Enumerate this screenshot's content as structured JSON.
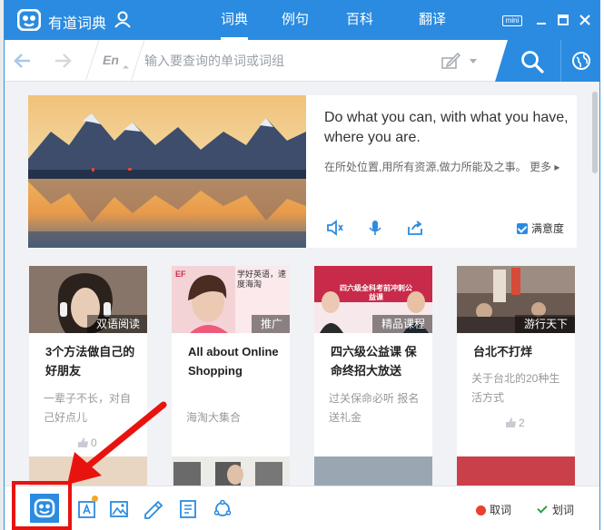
{
  "app": {
    "name": "有道词典",
    "brand_color": "#2a8be0"
  },
  "tabs": [
    {
      "label": "词典",
      "active": true
    },
    {
      "label": "例句",
      "active": false
    },
    {
      "label": "百科",
      "active": false
    },
    {
      "label": "翻译",
      "active": false
    }
  ],
  "window_controls": {
    "mini_label": "mini"
  },
  "search": {
    "lang": "En",
    "placeholder": "输入要查询的单词或词组"
  },
  "banner": {
    "quote_en": "Do what you can, with what you have, where you are.",
    "quote_zh": "在所处位置,用所有资源,做力所能及之事。",
    "more": "更多 ▸",
    "satisfaction_label": "满意度"
  },
  "cards": [
    {
      "tag": "双语阅读",
      "title": "3个方法做自己的好朋友",
      "desc": "一辈子不长，对自己好点儿",
      "likes": "0"
    },
    {
      "tag": "推广",
      "title": "All about Online Shopping",
      "desc": "海淘大集合",
      "likes": ""
    },
    {
      "tag": "精品课程",
      "title": "四六级公益课 保命终招大放送",
      "desc": "过关保命必听 报名送礼金",
      "likes": ""
    },
    {
      "tag": "游行天下",
      "title": "台北不打烊",
      "desc": "关于台北的20种生活方式",
      "likes": "2"
    }
  ],
  "card_images": {
    "promo_ef_text": "学好英语，速度海淘",
    "course_banner_text": "四六级全科考前冲刺公益课",
    "promo_logo": "EF"
  },
  "bottombar": {
    "icons": [
      "home-icon",
      "ocr-icon",
      "image-translate-icon",
      "pen-icon",
      "document-icon",
      "sync-icon"
    ],
    "qu_ci_label": "取词",
    "hua_ci_label": "划词"
  },
  "annotation": {
    "highlight_color": "#e8130f"
  }
}
